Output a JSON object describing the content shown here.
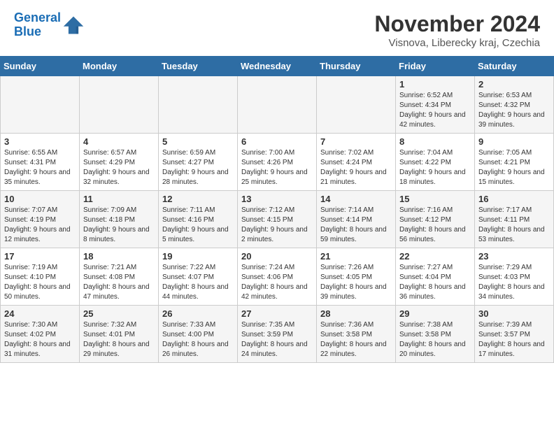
{
  "header": {
    "logo_line1": "General",
    "logo_line2": "Blue",
    "month_title": "November 2024",
    "location": "Visnova, Liberecky kraj, Czechia"
  },
  "days_of_week": [
    "Sunday",
    "Monday",
    "Tuesday",
    "Wednesday",
    "Thursday",
    "Friday",
    "Saturday"
  ],
  "weeks": [
    [
      {
        "day": "",
        "info": ""
      },
      {
        "day": "",
        "info": ""
      },
      {
        "day": "",
        "info": ""
      },
      {
        "day": "",
        "info": ""
      },
      {
        "day": "",
        "info": ""
      },
      {
        "day": "1",
        "info": "Sunrise: 6:52 AM\nSunset: 4:34 PM\nDaylight: 9 hours and 42 minutes."
      },
      {
        "day": "2",
        "info": "Sunrise: 6:53 AM\nSunset: 4:32 PM\nDaylight: 9 hours and 39 minutes."
      }
    ],
    [
      {
        "day": "3",
        "info": "Sunrise: 6:55 AM\nSunset: 4:31 PM\nDaylight: 9 hours and 35 minutes."
      },
      {
        "day": "4",
        "info": "Sunrise: 6:57 AM\nSunset: 4:29 PM\nDaylight: 9 hours and 32 minutes."
      },
      {
        "day": "5",
        "info": "Sunrise: 6:59 AM\nSunset: 4:27 PM\nDaylight: 9 hours and 28 minutes."
      },
      {
        "day": "6",
        "info": "Sunrise: 7:00 AM\nSunset: 4:26 PM\nDaylight: 9 hours and 25 minutes."
      },
      {
        "day": "7",
        "info": "Sunrise: 7:02 AM\nSunset: 4:24 PM\nDaylight: 9 hours and 21 minutes."
      },
      {
        "day": "8",
        "info": "Sunrise: 7:04 AM\nSunset: 4:22 PM\nDaylight: 9 hours and 18 minutes."
      },
      {
        "day": "9",
        "info": "Sunrise: 7:05 AM\nSunset: 4:21 PM\nDaylight: 9 hours and 15 minutes."
      }
    ],
    [
      {
        "day": "10",
        "info": "Sunrise: 7:07 AM\nSunset: 4:19 PM\nDaylight: 9 hours and 12 minutes."
      },
      {
        "day": "11",
        "info": "Sunrise: 7:09 AM\nSunset: 4:18 PM\nDaylight: 9 hours and 8 minutes."
      },
      {
        "day": "12",
        "info": "Sunrise: 7:11 AM\nSunset: 4:16 PM\nDaylight: 9 hours and 5 minutes."
      },
      {
        "day": "13",
        "info": "Sunrise: 7:12 AM\nSunset: 4:15 PM\nDaylight: 9 hours and 2 minutes."
      },
      {
        "day": "14",
        "info": "Sunrise: 7:14 AM\nSunset: 4:14 PM\nDaylight: 8 hours and 59 minutes."
      },
      {
        "day": "15",
        "info": "Sunrise: 7:16 AM\nSunset: 4:12 PM\nDaylight: 8 hours and 56 minutes."
      },
      {
        "day": "16",
        "info": "Sunrise: 7:17 AM\nSunset: 4:11 PM\nDaylight: 8 hours and 53 minutes."
      }
    ],
    [
      {
        "day": "17",
        "info": "Sunrise: 7:19 AM\nSunset: 4:10 PM\nDaylight: 8 hours and 50 minutes."
      },
      {
        "day": "18",
        "info": "Sunrise: 7:21 AM\nSunset: 4:08 PM\nDaylight: 8 hours and 47 minutes."
      },
      {
        "day": "19",
        "info": "Sunrise: 7:22 AM\nSunset: 4:07 PM\nDaylight: 8 hours and 44 minutes."
      },
      {
        "day": "20",
        "info": "Sunrise: 7:24 AM\nSunset: 4:06 PM\nDaylight: 8 hours and 42 minutes."
      },
      {
        "day": "21",
        "info": "Sunrise: 7:26 AM\nSunset: 4:05 PM\nDaylight: 8 hours and 39 minutes."
      },
      {
        "day": "22",
        "info": "Sunrise: 7:27 AM\nSunset: 4:04 PM\nDaylight: 8 hours and 36 minutes."
      },
      {
        "day": "23",
        "info": "Sunrise: 7:29 AM\nSunset: 4:03 PM\nDaylight: 8 hours and 34 minutes."
      }
    ],
    [
      {
        "day": "24",
        "info": "Sunrise: 7:30 AM\nSunset: 4:02 PM\nDaylight: 8 hours and 31 minutes."
      },
      {
        "day": "25",
        "info": "Sunrise: 7:32 AM\nSunset: 4:01 PM\nDaylight: 8 hours and 29 minutes."
      },
      {
        "day": "26",
        "info": "Sunrise: 7:33 AM\nSunset: 4:00 PM\nDaylight: 8 hours and 26 minutes."
      },
      {
        "day": "27",
        "info": "Sunrise: 7:35 AM\nSunset: 3:59 PM\nDaylight: 8 hours and 24 minutes."
      },
      {
        "day": "28",
        "info": "Sunrise: 7:36 AM\nSunset: 3:58 PM\nDaylight: 8 hours and 22 minutes."
      },
      {
        "day": "29",
        "info": "Sunrise: 7:38 AM\nSunset: 3:58 PM\nDaylight: 8 hours and 20 minutes."
      },
      {
        "day": "30",
        "info": "Sunrise: 7:39 AM\nSunset: 3:57 PM\nDaylight: 8 hours and 17 minutes."
      }
    ]
  ]
}
